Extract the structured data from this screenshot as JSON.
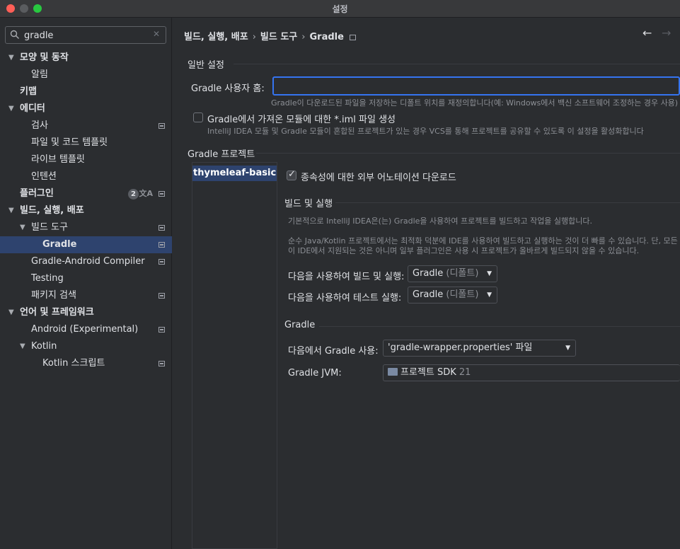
{
  "window": {
    "title": "설정"
  },
  "search": {
    "value": "gradle"
  },
  "sidebar": {
    "items": [
      {
        "label": "모양 및 동작"
      },
      {
        "label": "알림"
      },
      {
        "label": "키맵"
      },
      {
        "label": "에디터"
      },
      {
        "label": "검사"
      },
      {
        "label": "파일 및 코드 템플릿"
      },
      {
        "label": "라이브 템플릿"
      },
      {
        "label": "인텐션"
      },
      {
        "label": "플러그인",
        "badge": "2"
      },
      {
        "label": "빌드, 실행, 배포"
      },
      {
        "label": "빌드 도구"
      },
      {
        "label": "Gradle"
      },
      {
        "label": "Gradle-Android Compiler"
      },
      {
        "label": "Testing"
      },
      {
        "label": "패키지 검색"
      },
      {
        "label": "언어 및 프레임워크"
      },
      {
        "label": "Android (Experimental)"
      },
      {
        "label": "Kotlin"
      },
      {
        "label": "Kotlin 스크립트"
      }
    ]
  },
  "breadcrumb": [
    "빌드, 실행, 배포",
    "빌드 도구",
    "Gradle"
  ],
  "general": {
    "section_title": "일반 설정",
    "user_home_label": "Gradle 사용자 홈:",
    "user_home_value": "",
    "user_home_hint": "Gradle이 다운로드된 파일을 저장하는 디폴트 위치를 재정의합니다(예: Windows에서 백신 소프트웨어 조정하는 경우 사용)",
    "iml_label": "Gradle에서 가져온 모듈에 대한 *.iml 파일 생성",
    "iml_hint": "IntelliJ IDEA 모듈 및 Gradle 모듈이 혼합된 프로젝트가 있는 경우 VCS를 통해 프로젝트를 공유할 수 있도록 이 설정을 활성화합니다",
    "iml_checked": false
  },
  "projects": {
    "section_title": "Gradle 프로젝트",
    "items": [
      "thymeleaf-basic"
    ],
    "download_annotations_label": "종속성에 대한 외부 어노테이션 다운로드",
    "download_annotations_checked": true
  },
  "build_run": {
    "section_title": "빌드 및 실행",
    "desc1": "기본적으로 IntelliJ IDEA은(는) Gradle을 사용하여 프로젝트를 빌드하고 작업을 실행합니다.",
    "desc2": "순수 Java/Kotlin 프로젝트에서는 최적화 덕분에 IDE를 사용하여 빌드하고 실행하는 것이 더 빠를 수 있습니다. 단, 모든 Grad",
    "desc3": "이 IDE에서 지원되는 것은 아니며 일부 플러그인은 사용 시 프로젝트가 올바르게 빌드되지 않을 수 있습니다.",
    "build_run_label": "다음을 사용하여 빌드 및 실행:",
    "build_run_value": "Gradle",
    "build_run_suffix": "(디폴트)",
    "test_label": "다음을 사용하여 테스트 실행:",
    "test_value": "Gradle",
    "test_suffix": "(디폴트)"
  },
  "gradle": {
    "section_title": "Gradle",
    "use_from_label": "다음에서 Gradle 사용:",
    "use_from_value": "'gradle-wrapper.properties' 파일",
    "jvm_label": "Gradle JVM:",
    "jvm_value": "프로젝트 SDK",
    "jvm_version": "21"
  }
}
